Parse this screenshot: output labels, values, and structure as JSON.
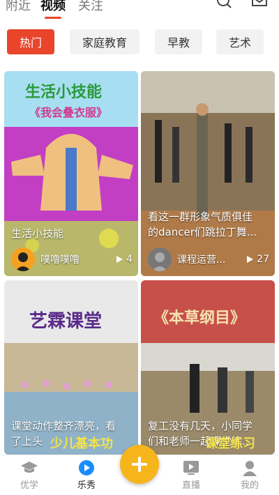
{
  "top_tabs": [
    {
      "label": "附近"
    },
    {
      "label": "视频",
      "active": true
    },
    {
      "label": "关注"
    }
  ],
  "icons": {
    "search": "search-icon",
    "message": "message-icon"
  },
  "categories": [
    {
      "label": "热门",
      "active": true
    },
    {
      "label": "家庭教育"
    },
    {
      "label": "早教"
    },
    {
      "label": "艺术"
    }
  ],
  "cards": [
    {
      "thumb_title": "生活小技能",
      "thumb_subtitle": "《我会叠衣服》",
      "caption": "生活小技能",
      "author": "噗噜噗噜",
      "plays": "4"
    },
    {
      "caption_line1": "看这一群形象气质俱佳",
      "caption_line2": "的dancer们跳拉丁舞...",
      "author": "课程运营...",
      "plays": "27"
    },
    {
      "thumb_title": "艺霖课堂",
      "caption_line1": "课堂动作整齐漂亮，看",
      "caption_line2": "了上头",
      "overlay_text": "少儿基本功"
    },
    {
      "thumb_title": "《本草纲目》",
      "caption_line1": "复工没有几天，小同学",
      "caption_line2": "们和老师一起课堂练...",
      "overlay_text": "课堂练习"
    }
  ],
  "bottom_nav": [
    {
      "label": "优学",
      "icon": "graduation-cap-icon"
    },
    {
      "label": "乐秀",
      "icon": "play-bubble-icon",
      "active": true
    },
    {
      "label": "plus",
      "icon": "plus-icon"
    },
    {
      "label": "直播",
      "icon": "live-tv-icon"
    },
    {
      "label": "我的",
      "icon": "profile-icon"
    }
  ],
  "colors": {
    "accent": "#e8452a",
    "fab": "#f7b51c",
    "active_nav": "#1a8cff"
  }
}
